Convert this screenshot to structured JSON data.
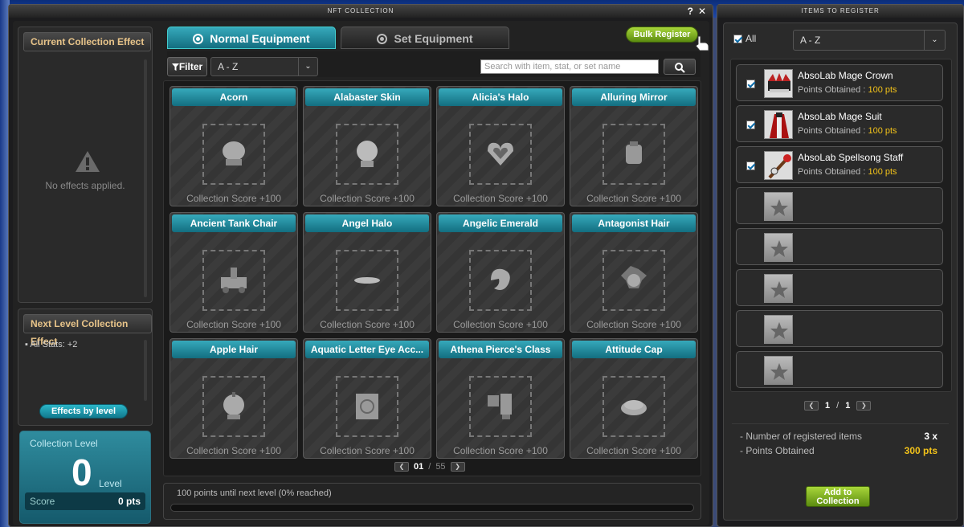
{
  "main_window": {
    "title": "NFT COLLECTION",
    "help": "?",
    "close": "✕"
  },
  "left": {
    "current_effect_title": "Current Collection Effect",
    "no_effects": "No effects applied.",
    "next_level_title": "Next Level Collection Effect",
    "next_stat": "All Stats: +2",
    "effects_by_level": "Effects by level",
    "collection_level_label": "Collection Level",
    "level_value": "0",
    "level_word": "Level",
    "score_label": "Score",
    "score_value": "0 pts"
  },
  "tabs": [
    {
      "label": "Normal Equipment",
      "active": true
    },
    {
      "label": "Set Equipment",
      "active": false
    }
  ],
  "bulk_register": "Bulk Register",
  "toolbar": {
    "filter": "Filter",
    "sort": "A - Z",
    "search_placeholder": "Search with item, stat, or set name"
  },
  "cards": [
    {
      "name": "Acorn",
      "score": "Collection Score +100",
      "icon": "acorn-icon"
    },
    {
      "name": "Alabaster Skin",
      "score": "Collection Score +100",
      "icon": "head-icon"
    },
    {
      "name": "Alicia's Halo",
      "score": "Collection Score +100",
      "icon": "heart-halo-icon"
    },
    {
      "name": "Alluring Mirror",
      "score": "Collection Score +100",
      "icon": "mirror-icon"
    },
    {
      "name": "Ancient Tank Chair",
      "score": "Collection Score +100",
      "icon": "tank-icon"
    },
    {
      "name": "Angel Halo",
      "score": "Collection Score +100",
      "icon": "halo-icon"
    },
    {
      "name": "Angelic Emerald",
      "score": "Collection Score +100",
      "icon": "emerald-icon"
    },
    {
      "name": "Antagonist Hair",
      "score": "Collection Score +100",
      "icon": "hair-icon"
    },
    {
      "name": "Apple Hair",
      "score": "Collection Score +100",
      "icon": "apple-hair-icon"
    },
    {
      "name": "Aquatic Letter Eye Acc...",
      "score": "Collection Score +100",
      "icon": "eye-acc-icon"
    },
    {
      "name": "Athena Pierce's Class",
      "score": "Collection Score +100",
      "icon": "class-icon"
    },
    {
      "name": "Attitude Cap",
      "score": "Collection Score +100",
      "icon": "cap-icon"
    }
  ],
  "pager": {
    "current": "01",
    "sep": "/",
    "total": "55"
  },
  "progress": {
    "text": "100 points until next level (0% reached)",
    "fraction": 0
  },
  "right_window": {
    "title": "ITEMS TO REGISTER",
    "all": "All",
    "sort": "A - Z",
    "items": [
      {
        "name": "AbsoLab Mage Crown",
        "pts_label": "Points Obtained :",
        "pts": "100 pts",
        "checked": true
      },
      {
        "name": "AbsoLab Mage Suit",
        "pts_label": "Points Obtained :",
        "pts": "100 pts",
        "checked": true
      },
      {
        "name": "AbsoLab Spellsong Staff",
        "pts_label": "Points Obtained :",
        "pts": "100 pts",
        "checked": true
      }
    ],
    "pager": {
      "current": "1",
      "sep": "/",
      "total": "1"
    },
    "summary": {
      "count_label": "- Number of registered items",
      "count_value": "3 x",
      "points_label": "- Points Obtained",
      "points_value": "300 pts"
    },
    "add_line1": "Add to",
    "add_line2": "Collection"
  },
  "colors": {
    "accent_teal": "#2a9aae",
    "green_btn": "#8bbb25",
    "points_yellow": "#f2c21a"
  }
}
